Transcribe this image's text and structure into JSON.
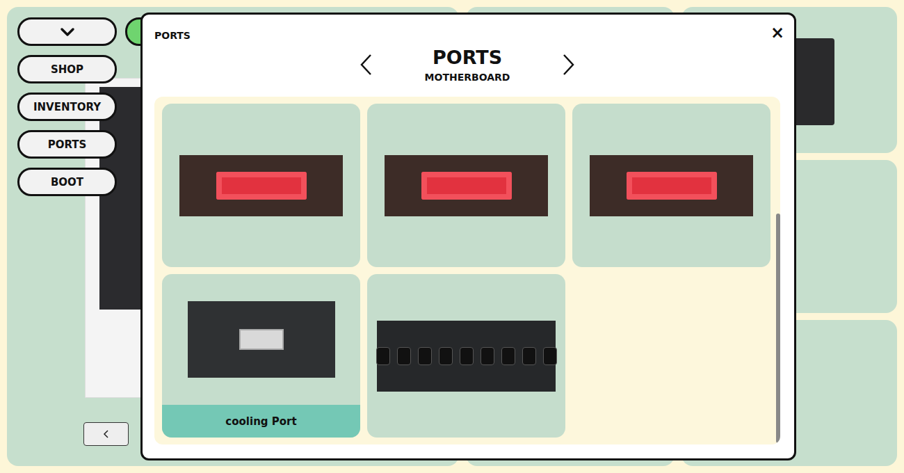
{
  "sidebar": {
    "items": [
      {
        "label": "SHOP",
        "selected": false
      },
      {
        "label": "INVENTORY",
        "selected": false
      },
      {
        "label": "PORTS",
        "selected": true
      },
      {
        "label": "BOOT",
        "selected": false
      }
    ]
  },
  "modal": {
    "title": "PORTS",
    "close": "×",
    "heading": "PORTS",
    "subheading": "MOTHERBOARD"
  },
  "ports": [
    {
      "kind": "sata",
      "label": null,
      "highlighted": false
    },
    {
      "kind": "sata",
      "label": null,
      "highlighted": false
    },
    {
      "kind": "sata",
      "label": null,
      "highlighted": false
    },
    {
      "kind": "fan",
      "label": "cooling Port",
      "highlighted": true
    },
    {
      "kind": "panel",
      "label": null,
      "highlighted": false
    }
  ],
  "scrollbar": {
    "level": 0.67,
    "at_end": true
  }
}
